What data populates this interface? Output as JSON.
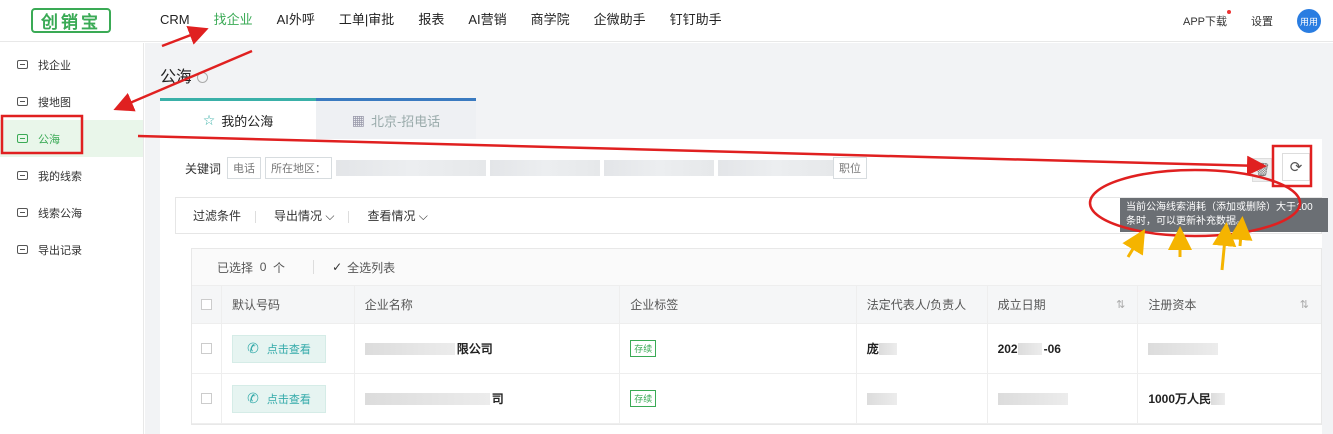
{
  "logo": "创销宝",
  "nav": [
    "CRM",
    "找企业",
    "AI外呼",
    "工单|审批",
    "报表",
    "AI营销",
    "商学院",
    "企微助手",
    "钉钉助手"
  ],
  "top_right": {
    "app_download": "APP下载",
    "settings": "设置",
    "avatar": "用用"
  },
  "sidebar": [
    "找企业",
    "搜地图",
    "公海",
    "我的线索",
    "线索公海",
    "导出记录"
  ],
  "page_title": "公海",
  "tabs": [
    "我的公海",
    "北京-招电话"
  ],
  "filter": {
    "label": "关键词",
    "chip1": "电话",
    "chip2": "所在地区：",
    "chip_last": "职位"
  },
  "toolbar": [
    "过滤条件",
    "导出情况 ⌵",
    "查看情况 ⌵"
  ],
  "tooltip": "当前公海线索消耗（添加或删除）大于100条时，可以更新补充数据。",
  "selection": {
    "label": "已选择",
    "count": "0",
    "unit": "个",
    "select_all": "全选列表"
  },
  "columns": [
    "默认号码",
    "企业名称",
    "企业标签",
    "法定代表人/负责人",
    "成立日期",
    "注册资本"
  ],
  "rows": [
    {
      "call": "点击查看",
      "company": "限公司",
      "tag": "存续",
      "rep": "庞",
      "date": "202",
      "date_tail": "-06",
      "capital": ""
    },
    {
      "call": "点击查看",
      "company": "司",
      "tag": "存续",
      "rep": "",
      "date": "",
      "date_tail": "",
      "capital": "1000万人民"
    }
  ],
  "colors": {
    "accent": "#3aaa55",
    "annotation": "#e02020",
    "arrow_yellow": "#f5b400"
  }
}
